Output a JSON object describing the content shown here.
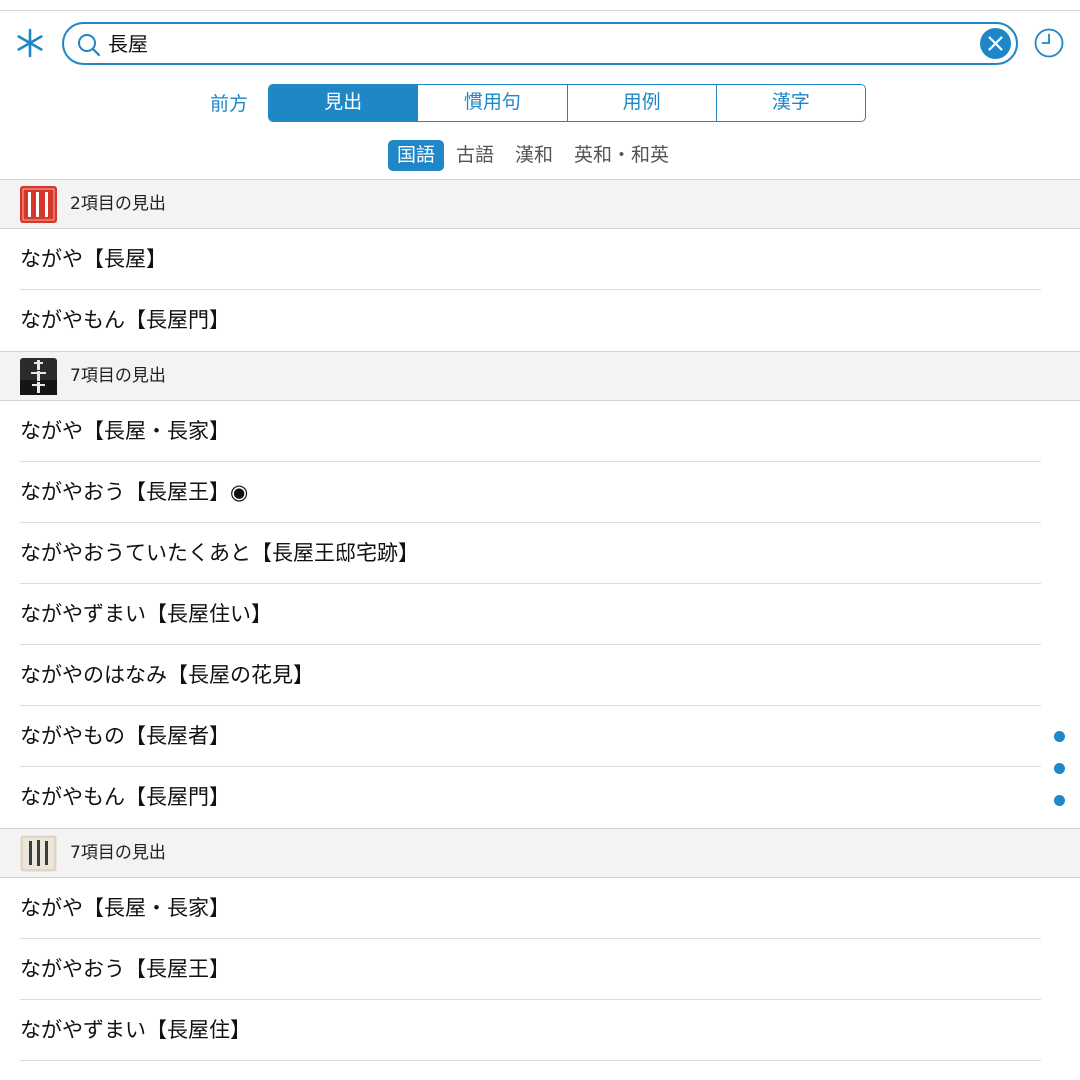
{
  "search": {
    "query": "長屋"
  },
  "modes": {
    "prefix_label": "前方",
    "segments": [
      "見出",
      "慣用句",
      "用例",
      "漢字"
    ],
    "active_index": 0
  },
  "dictionary_tabs": {
    "items": [
      "国語",
      "古語",
      "漢和",
      "英和・和英"
    ],
    "active_index": 0
  },
  "sections": [
    {
      "book_icon": "shin-meikai-kokugo-jiten-icon",
      "book_icon_text": "新明解国語辞典",
      "count_label": "2項目の見出",
      "entries": [
        "ながや【長屋】",
        "ながやもん【長屋門】"
      ]
    },
    {
      "book_icon": "daijirin-icon",
      "book_icon_text": "大辞林",
      "count_label": "7項目の見出",
      "entries": [
        "ながや【長屋・長家】",
        "ながやおう【長屋王】◉",
        "ながやおうていたくあと【長屋王邸宅跡】",
        "ながやずまい【長屋住い】",
        "ながやのはなみ【長屋の花見】",
        "ながやもの【長屋者】",
        "ながやもん【長屋門】"
      ]
    },
    {
      "book_icon": "nihon-kokugo-daijiten-icon",
      "book_icon_text": "日本国語大辞典",
      "count_label": "7項目の見出",
      "entries": [
        "ながや【長屋・長家】",
        "ながやおう【長屋王】",
        "ながやずまい【長屋住】"
      ]
    }
  ],
  "colors": {
    "accent": "#1f87c6",
    "header_bg": "#f3f3f3",
    "separator": "#dcdcdc"
  }
}
